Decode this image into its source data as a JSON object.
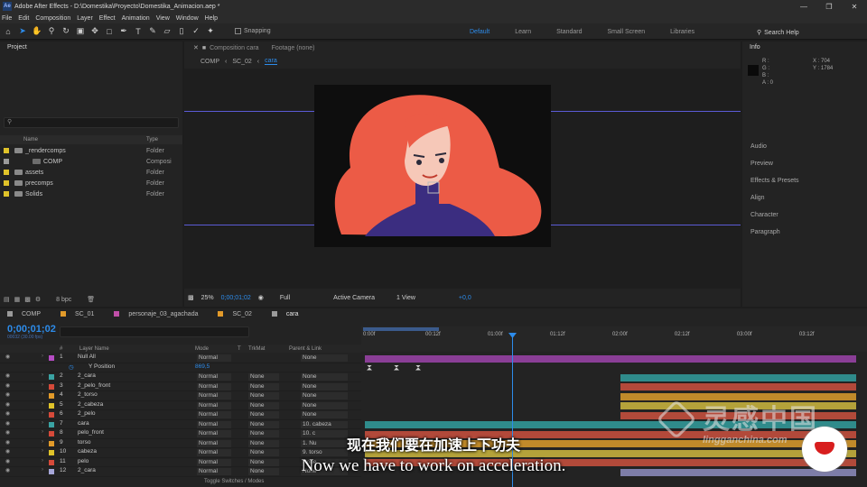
{
  "window": {
    "title": "Adobe After Effects - D:\\Domestika\\Proyecto\\Domestika_Animacion.aep *",
    "app_icon": "Ae"
  },
  "menu": [
    "File",
    "Edit",
    "Composition",
    "Layer",
    "Effect",
    "Animation",
    "View",
    "Window",
    "Help"
  ],
  "toolbar": {
    "snapping": "Snapping",
    "workspaces": [
      "Default",
      "Learn",
      "Standard",
      "Small Screen",
      "Libraries"
    ],
    "active_workspace": "Default",
    "search_help": "Search Help"
  },
  "project": {
    "title": "Project",
    "columns": {
      "name": "Name",
      "type": "Type"
    },
    "items": [
      {
        "name": "_rendercomps",
        "type": "Folder",
        "color": "#e0c32a",
        "indent": 0
      },
      {
        "name": "COMP",
        "type": "Composi",
        "color": "#9a9a9a",
        "indent": 1
      },
      {
        "name": "assets",
        "type": "Folder",
        "color": "#e0c32a",
        "indent": 0
      },
      {
        "name": "precomps",
        "type": "Folder",
        "color": "#e0c32a",
        "indent": 0
      },
      {
        "name": "Solids",
        "type": "Folder",
        "color": "#e0c32a",
        "indent": 0
      }
    ],
    "bpc": "8 bpc"
  },
  "composition": {
    "tab": "Composition cara",
    "footage": "Footage (none)",
    "breadcrumbs": [
      "COMP",
      "SC_02",
      "cara"
    ],
    "active_crumb": "cara",
    "viewer_bar": {
      "zoom": "25%",
      "timecode": "0;00;01;02",
      "resolution": "Full",
      "camera": "Active Camera",
      "views": "1 View",
      "exposure": "+0,0"
    }
  },
  "info": {
    "title": "Info",
    "rgba": [
      "R :",
      "G :",
      "B :",
      "A : 0"
    ],
    "coords": [
      "X : 704",
      "Y : 1784"
    ]
  },
  "right_panels": [
    "Audio",
    "Preview",
    "Effects & Presets",
    "Align",
    "Character",
    "Paragraph"
  ],
  "timeline": {
    "tabs": [
      {
        "label": "COMP",
        "color": "#9a9a9a"
      },
      {
        "label": "SC_01",
        "color": "#e29a2a"
      },
      {
        "label": "personaje_03_agachada",
        "color": "#c04fa8"
      },
      {
        "label": "SC_02",
        "color": "#e29a2a"
      },
      {
        "label": "cara",
        "color": "#9a9a9a"
      }
    ],
    "timecode": "0;00;01;02",
    "fps": "00032 (30.00 fps)",
    "columns": {
      "num": "#",
      "name": "Layer Name",
      "mode": "Mode",
      "t": "T",
      "trkmat": "TrkMat",
      "parent": "Parent & Link"
    },
    "ruler": [
      "0:00f",
      "00:12f",
      "01:00f",
      "01:12f",
      "02:00f",
      "02:12f",
      "03:00f",
      "03:12f"
    ],
    "layers": [
      {
        "num": "1",
        "name": "Null All",
        "mode": "Normal",
        "trkmat": "",
        "parent": "None",
        "color": "#b64cc4",
        "bar": "#8a3e96",
        "bar_start": 0.0
      },
      {
        "num": "",
        "name": "Y Position",
        "mode": "869,5",
        "trkmat": "",
        "parent": "",
        "color": "",
        "bar": "",
        "bar_start": 0.0,
        "prop": true
      },
      {
        "num": "2",
        "name": "2_cara",
        "mode": "Normal",
        "trkmat": "None",
        "parent": "None",
        "color": "#3aa3a3",
        "bar": "#2f8b8b",
        "bar_start": 0.52
      },
      {
        "num": "3",
        "name": "2_pelo_front",
        "mode": "Normal",
        "trkmat": "None",
        "parent": "None",
        "color": "#d64a3a",
        "bar": "#b2493a",
        "bar_start": 0.52
      },
      {
        "num": "4",
        "name": "2_torso",
        "mode": "Normal",
        "trkmat": "None",
        "parent": "None",
        "color": "#e29a2a",
        "bar": "#c08a2a",
        "bar_start": 0.52
      },
      {
        "num": "5",
        "name": "2_cabeza",
        "mode": "Normal",
        "trkmat": "None",
        "parent": "None",
        "color": "#e0c32a",
        "bar": "#b4a23a",
        "bar_start": 0.52
      },
      {
        "num": "6",
        "name": "2_pelo",
        "mode": "Normal",
        "trkmat": "None",
        "parent": "None",
        "color": "#d64a3a",
        "bar": "#b24a3a",
        "bar_start": 0.52
      },
      {
        "num": "7",
        "name": "cara",
        "mode": "Normal",
        "trkmat": "None",
        "parent": "10. cabeza",
        "color": "#3aa3a3",
        "bar": "#2f8b8b",
        "bar_start": 0.0
      },
      {
        "num": "8",
        "name": "pelo_front",
        "mode": "Normal",
        "trkmat": "None",
        "parent": "10. c",
        "color": "#d64a3a",
        "bar": "#b2493a",
        "bar_start": 0.0
      },
      {
        "num": "9",
        "name": "torso",
        "mode": "Normal",
        "trkmat": "None",
        "parent": "1. Nu",
        "color": "#e29a2a",
        "bar": "#c08a2a",
        "bar_start": 0.0
      },
      {
        "num": "10",
        "name": "cabeza",
        "mode": "Normal",
        "trkmat": "None",
        "parent": "9. torso",
        "color": "#e0c32a",
        "bar": "#b4a23a",
        "bar_start": 0.0
      },
      {
        "num": "11",
        "name": "pelo",
        "mode": "Normal",
        "trkmat": "None",
        "parent": "None",
        "color": "#d64a3a",
        "bar": "#b24a3a",
        "bar_start": 0.0
      },
      {
        "num": "12",
        "name": "2_cara",
        "mode": "Normal",
        "trkmat": "None",
        "parent": "None",
        "color": "#a6a6d8",
        "bar": "#7d7da8",
        "bar_start": 0.52
      }
    ],
    "footer": "Toggle Switches / Modes"
  },
  "subtitles": {
    "zh": "现在我们要在加速上下功夫",
    "en": "Now we have to work on acceleration."
  },
  "watermark": {
    "brand": "灵感中国",
    "url": "lingganchina.com"
  }
}
